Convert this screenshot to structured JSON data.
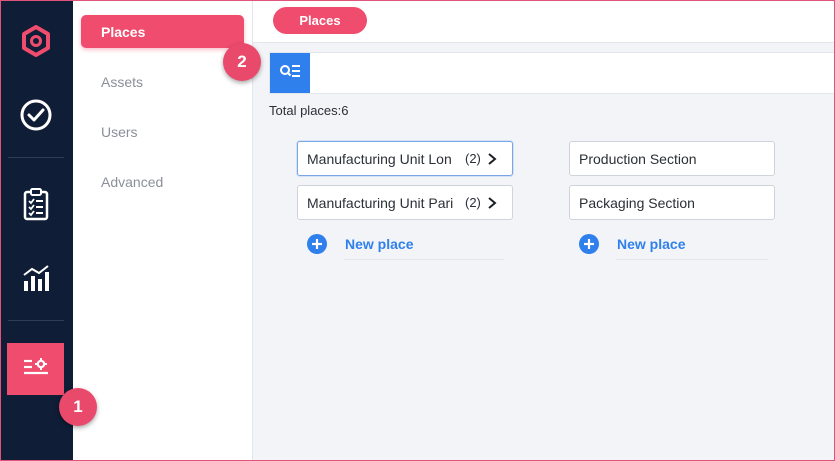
{
  "rail": {
    "items": [
      {
        "icon": "hexagon-logo-icon"
      },
      {
        "icon": "check-circle-icon"
      },
      {
        "icon": "clipboard-list-icon"
      },
      {
        "icon": "bar-chart-icon"
      },
      {
        "icon": "settings-list-icon",
        "active": true
      }
    ]
  },
  "subnav": {
    "items": [
      {
        "label": "Places",
        "active": true
      },
      {
        "label": "Assets"
      },
      {
        "label": "Users"
      },
      {
        "label": "Advanced"
      }
    ]
  },
  "header": {
    "pill_label": "Places"
  },
  "toolbar": {
    "search_icon": "search-list-icon"
  },
  "main": {
    "total_text": "Total places:6",
    "column1": {
      "cards": [
        {
          "name": "Manufacturing Unit Lon",
          "count": "(2)",
          "selected": true
        },
        {
          "name": "Manufacturing Unit Pari",
          "count": "(2)"
        }
      ],
      "new_place_label": "New place"
    },
    "column2": {
      "cards": [
        {
          "name": "Production Section"
        },
        {
          "name": "Packaging Section"
        }
      ],
      "new_place_label": "New place"
    }
  },
  "markers": {
    "one": "1",
    "two": "2"
  },
  "colors": {
    "accent": "#ef4c6e",
    "rail_bg": "#0f1d36",
    "link_blue": "#2f80ed",
    "main_bg": "#f3f4f8"
  }
}
